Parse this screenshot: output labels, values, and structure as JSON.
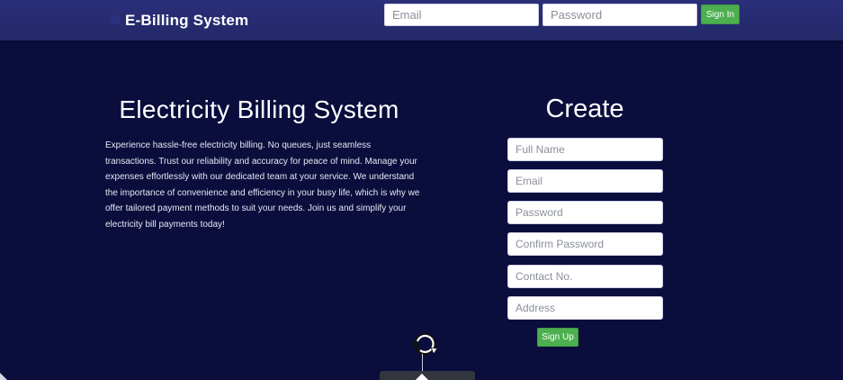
{
  "navbar": {
    "brand": "E-Billing System",
    "email_placeholder": "Email",
    "password_placeholder": "Password",
    "signin_label": "Sign In"
  },
  "hero": {
    "title": "Electricity Billing System",
    "description": "Experience hassle-free electricity billing. No queues, just seamless transactions. Trust our reliability and accuracy for peace of mind. Manage your expenses effortlessly with our dedicated team at your service. We understand the importance of convenience and efficiency in your busy life, which is why we offer tailored payment methods to suit your needs. Join us and simplify your electricity bill payments today!"
  },
  "signup_form": {
    "title": "Create",
    "fields": [
      {
        "placeholder": "Full Name"
      },
      {
        "placeholder": "Email"
      },
      {
        "placeholder": "Password"
      },
      {
        "placeholder": "Confirm Password"
      },
      {
        "placeholder": "Contact No."
      },
      {
        "placeholder": "Address"
      }
    ],
    "submit_label": "Sign Up"
  },
  "icons": {
    "loader": "refresh-icon"
  },
  "colors": {
    "background": "#0b0d3d",
    "navbar": "#262b6e",
    "button": "#4caf50"
  }
}
